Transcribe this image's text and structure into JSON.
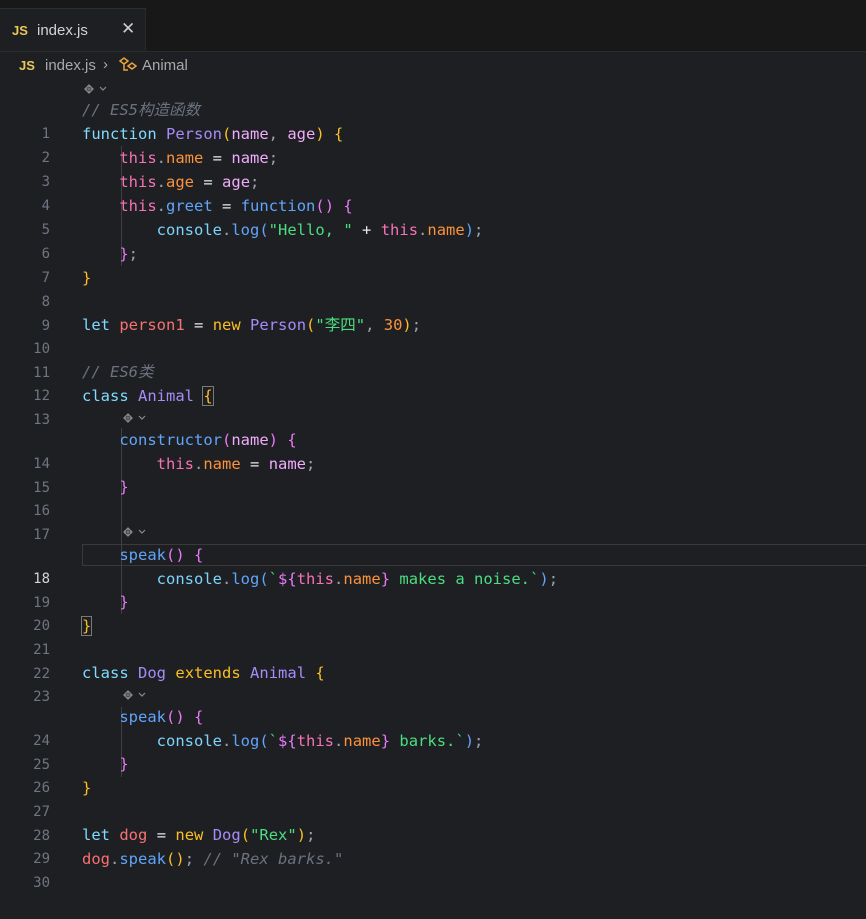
{
  "tab": {
    "icon": "JS",
    "filename": "index.js",
    "close": "✕"
  },
  "breadcrumb": {
    "file_icon": "JS",
    "file": "index.js",
    "separator": "›",
    "symbol": "Animal"
  },
  "code": {
    "c1": "// ES5构造函数",
    "kw_function": "function",
    "person": "Person",
    "name": "name",
    "age": "age",
    "this": "this",
    "greet": "greet",
    "console": "console",
    "log": "log",
    "hello": "\"Hello, \"",
    "plus": "+",
    "let": "let",
    "person1": "person1",
    "eq": "=",
    "new": "new",
    "lisi": "\"李四\"",
    "thirty": "30",
    "c2": "// ES6类",
    "class": "class",
    "animal": "Animal",
    "constructor": "constructor",
    "speak": "speak",
    "tpl_open": "`${",
    "tpl_close": "}",
    "makes": " makes a noise.`",
    "barks": " barks.`",
    "dog_cls": "Dog",
    "extends": "extends",
    "dog_var": "dog",
    "rex": "\"Rex\"",
    "c3": "// \"Rex barks.\""
  },
  "line_numbers": [
    "1",
    "2",
    "3",
    "4",
    "5",
    "6",
    "7",
    "8",
    "9",
    "10",
    "11",
    "12",
    "13",
    "14",
    "15",
    "16",
    "17",
    "18",
    "19",
    "20",
    "21",
    "22",
    "23",
    "24",
    "25",
    "26",
    "27",
    "28",
    "29",
    "30"
  ],
  "colors": {
    "background": "#1e1f22",
    "tabbar": "#181818",
    "js_badge": "#e8c85a"
  },
  "icons": {
    "codelens": "codelens-icon",
    "close": "close-icon",
    "class_symbol": "class-symbol-icon"
  }
}
